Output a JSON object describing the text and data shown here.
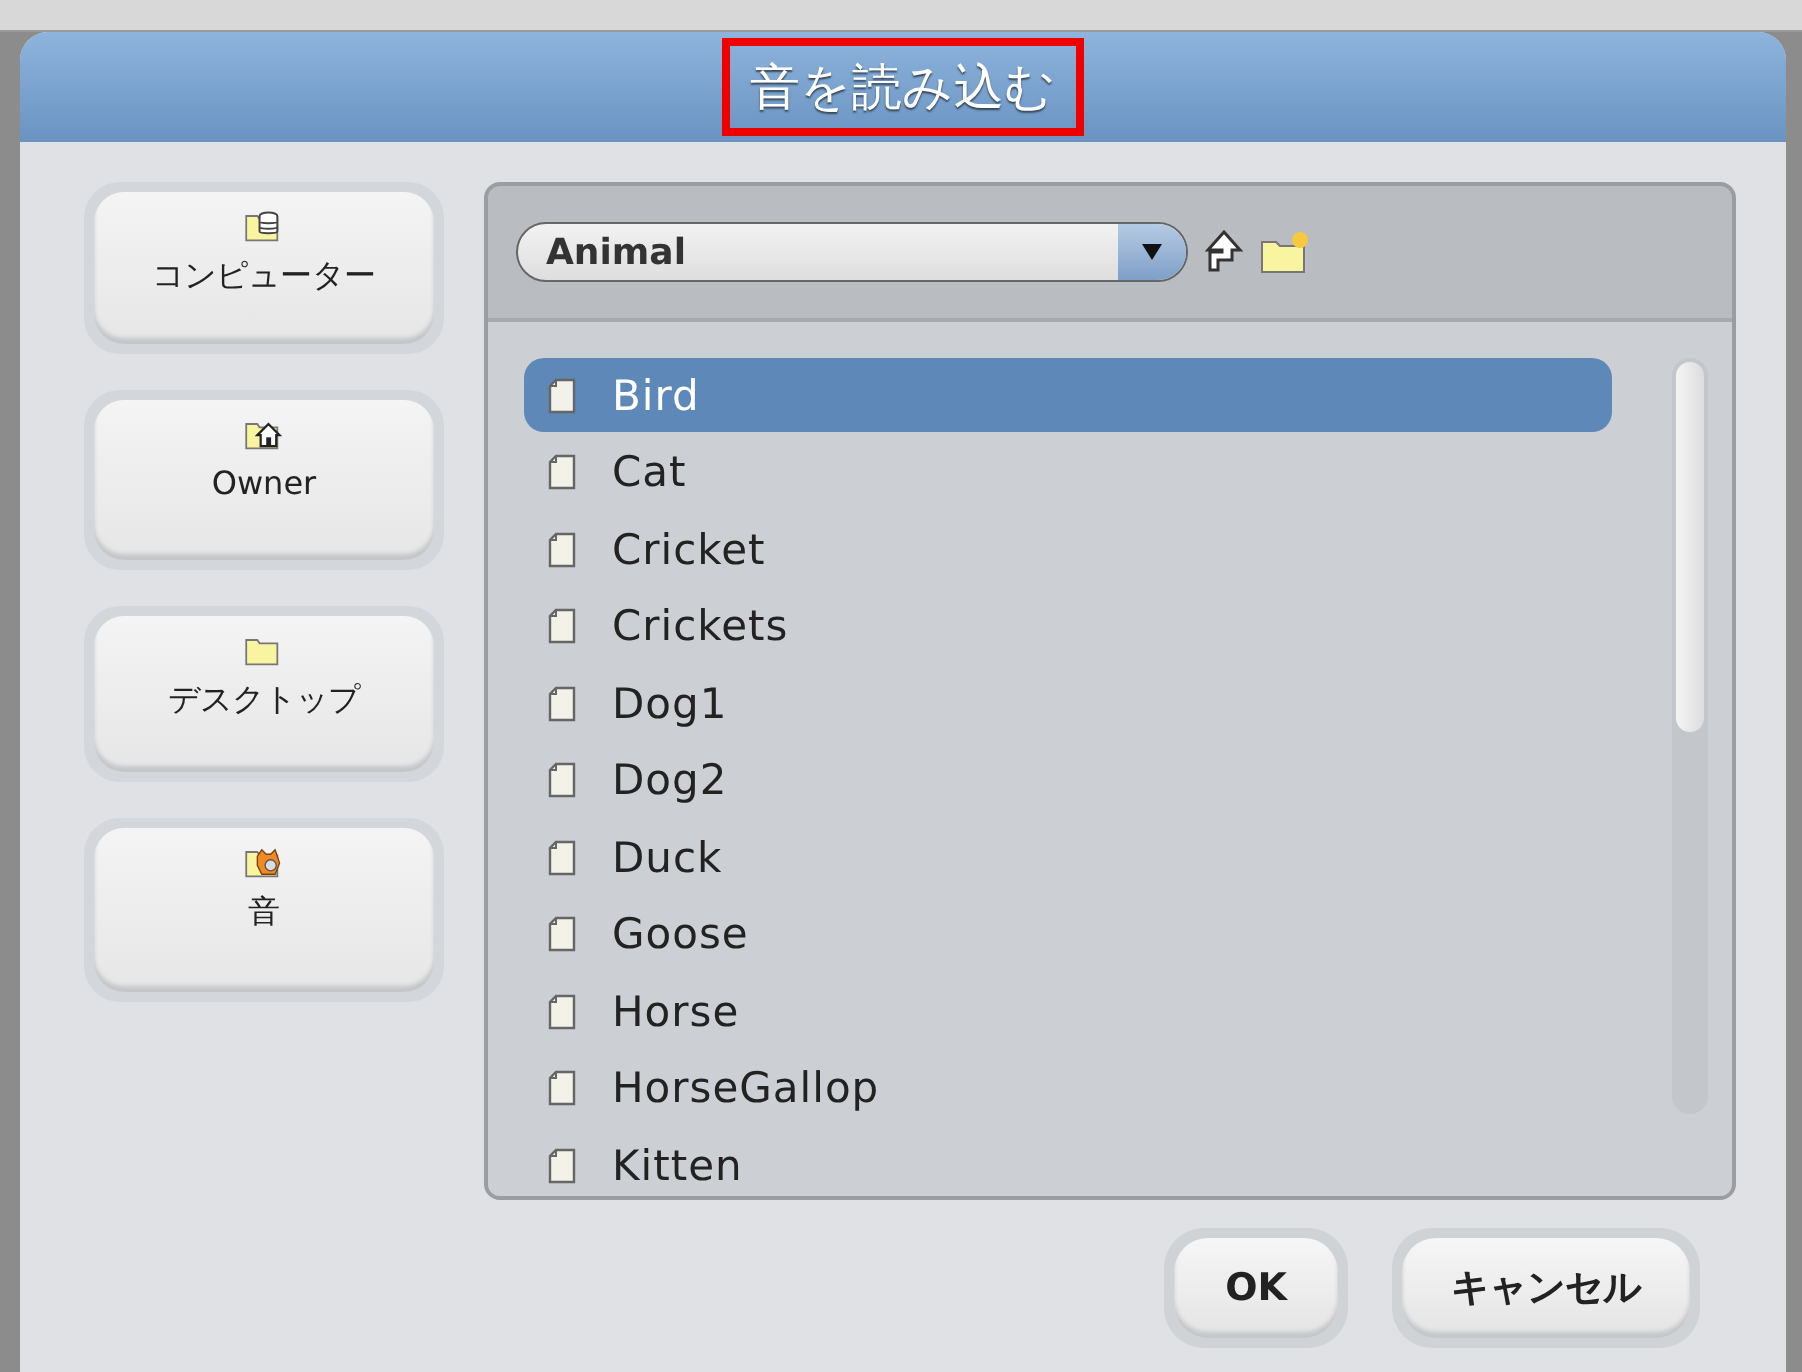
{
  "window": {
    "title": "音を読み込む",
    "title_highlighted": true
  },
  "sidebar": {
    "items": [
      {
        "label": "コンピューター",
        "kind": "computer"
      },
      {
        "label": "Owner",
        "kind": "home"
      },
      {
        "label": "デスクトップ",
        "kind": "folder"
      },
      {
        "label": "音",
        "kind": "sounds"
      }
    ]
  },
  "location": {
    "value": "Animal"
  },
  "files": [
    {
      "name": "Bird",
      "selected": true
    },
    {
      "name": "Cat",
      "selected": false
    },
    {
      "name": "Cricket",
      "selected": false
    },
    {
      "name": "Crickets",
      "selected": false
    },
    {
      "name": "Dog1",
      "selected": false
    },
    {
      "name": "Dog2",
      "selected": false
    },
    {
      "name": "Duck",
      "selected": false
    },
    {
      "name": "Goose",
      "selected": false
    },
    {
      "name": "Horse",
      "selected": false
    },
    {
      "name": "HorseGallop",
      "selected": false
    },
    {
      "name": "Kitten",
      "selected": false
    }
  ],
  "buttons": [
    {
      "label": "OK"
    },
    {
      "label": "キャンセル"
    }
  ]
}
